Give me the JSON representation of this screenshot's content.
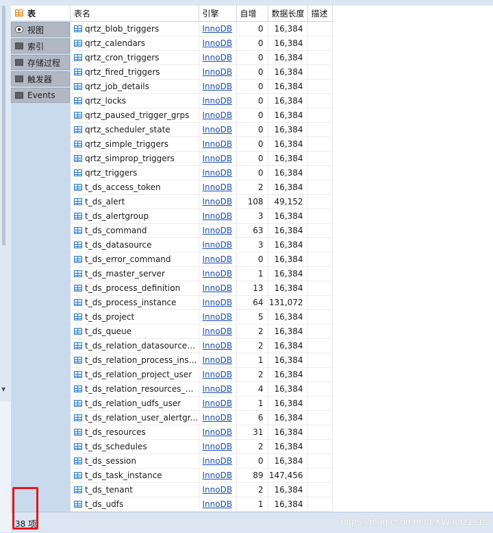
{
  "nav": [
    {
      "label": "表",
      "icon": "table-icon",
      "active": true
    },
    {
      "label": "视图",
      "icon": "eye-icon",
      "active": false
    },
    {
      "label": "索引",
      "icon": "index-icon",
      "active": false
    },
    {
      "label": "存储过程",
      "icon": "procedure-icon",
      "active": false
    },
    {
      "label": "触发器",
      "icon": "trigger-icon",
      "active": false
    },
    {
      "label": "Events",
      "icon": "events-icon",
      "active": false
    }
  ],
  "columns": [
    "表名",
    "引擎",
    "自增",
    "数据长度",
    "描述"
  ],
  "rows": [
    {
      "name": "qrtz_blob_triggers",
      "engine": "InnoDB",
      "auto_inc": "0",
      "data_length": "16,384"
    },
    {
      "name": "qrtz_calendars",
      "engine": "InnoDB",
      "auto_inc": "0",
      "data_length": "16,384"
    },
    {
      "name": "qrtz_cron_triggers",
      "engine": "InnoDB",
      "auto_inc": "0",
      "data_length": "16,384"
    },
    {
      "name": "qrtz_fired_triggers",
      "engine": "InnoDB",
      "auto_inc": "0",
      "data_length": "16,384"
    },
    {
      "name": "qrtz_job_details",
      "engine": "InnoDB",
      "auto_inc": "0",
      "data_length": "16,384"
    },
    {
      "name": "qrtz_locks",
      "engine": "InnoDB",
      "auto_inc": "0",
      "data_length": "16,384"
    },
    {
      "name": "qrtz_paused_trigger_grps",
      "engine": "InnoDB",
      "auto_inc": "0",
      "data_length": "16,384"
    },
    {
      "name": "qrtz_scheduler_state",
      "engine": "InnoDB",
      "auto_inc": "0",
      "data_length": "16,384"
    },
    {
      "name": "qrtz_simple_triggers",
      "engine": "InnoDB",
      "auto_inc": "0",
      "data_length": "16,384"
    },
    {
      "name": "qrtz_simprop_triggers",
      "engine": "InnoDB",
      "auto_inc": "0",
      "data_length": "16,384"
    },
    {
      "name": "qrtz_triggers",
      "engine": "InnoDB",
      "auto_inc": "0",
      "data_length": "16,384"
    },
    {
      "name": "t_ds_access_token",
      "engine": "InnoDB",
      "auto_inc": "2",
      "data_length": "16,384"
    },
    {
      "name": "t_ds_alert",
      "engine": "InnoDB",
      "auto_inc": "108",
      "data_length": "49,152"
    },
    {
      "name": "t_ds_alertgroup",
      "engine": "InnoDB",
      "auto_inc": "3",
      "data_length": "16,384"
    },
    {
      "name": "t_ds_command",
      "engine": "InnoDB",
      "auto_inc": "63",
      "data_length": "16,384"
    },
    {
      "name": "t_ds_datasource",
      "engine": "InnoDB",
      "auto_inc": "3",
      "data_length": "16,384"
    },
    {
      "name": "t_ds_error_command",
      "engine": "InnoDB",
      "auto_inc": "0",
      "data_length": "16,384"
    },
    {
      "name": "t_ds_master_server",
      "engine": "InnoDB",
      "auto_inc": "1",
      "data_length": "16,384"
    },
    {
      "name": "t_ds_process_definition",
      "engine": "InnoDB",
      "auto_inc": "13",
      "data_length": "16,384"
    },
    {
      "name": "t_ds_process_instance",
      "engine": "InnoDB",
      "auto_inc": "64",
      "data_length": "131,072"
    },
    {
      "name": "t_ds_project",
      "engine": "InnoDB",
      "auto_inc": "5",
      "data_length": "16,384"
    },
    {
      "name": "t_ds_queue",
      "engine": "InnoDB",
      "auto_inc": "2",
      "data_length": "16,384"
    },
    {
      "name": "t_ds_relation_datasource_...",
      "engine": "InnoDB",
      "auto_inc": "2",
      "data_length": "16,384"
    },
    {
      "name": "t_ds_relation_process_inst...",
      "engine": "InnoDB",
      "auto_inc": "1",
      "data_length": "16,384"
    },
    {
      "name": "t_ds_relation_project_user",
      "engine": "InnoDB",
      "auto_inc": "2",
      "data_length": "16,384"
    },
    {
      "name": "t_ds_relation_resources_us...",
      "engine": "InnoDB",
      "auto_inc": "4",
      "data_length": "16,384"
    },
    {
      "name": "t_ds_relation_udfs_user",
      "engine": "InnoDB",
      "auto_inc": "1",
      "data_length": "16,384"
    },
    {
      "name": "t_ds_relation_user_alertgr...",
      "engine": "InnoDB",
      "auto_inc": "6",
      "data_length": "16,384"
    },
    {
      "name": "t_ds_resources",
      "engine": "InnoDB",
      "auto_inc": "31",
      "data_length": "16,384"
    },
    {
      "name": "t_ds_schedules",
      "engine": "InnoDB",
      "auto_inc": "2",
      "data_length": "16,384"
    },
    {
      "name": "t_ds_session",
      "engine": "InnoDB",
      "auto_inc": "0",
      "data_length": "16,384"
    },
    {
      "name": "t_ds_task_instance",
      "engine": "InnoDB",
      "auto_inc": "89",
      "data_length": "147,456"
    },
    {
      "name": "t_ds_tenant",
      "engine": "InnoDB",
      "auto_inc": "2",
      "data_length": "16,384"
    },
    {
      "name": "t_ds_udfs",
      "engine": "InnoDB",
      "auto_inc": "1",
      "data_length": "16,384"
    }
  ],
  "status": {
    "count_label": "38 项",
    "watermark": "https://blog.csdn.net/LXWalaz1s1s"
  },
  "colors": {
    "highlight": "#e4161c",
    "link": "#1a4fb8",
    "nav_active": "#ffffff",
    "nav_bg": "#b1b8c3"
  }
}
